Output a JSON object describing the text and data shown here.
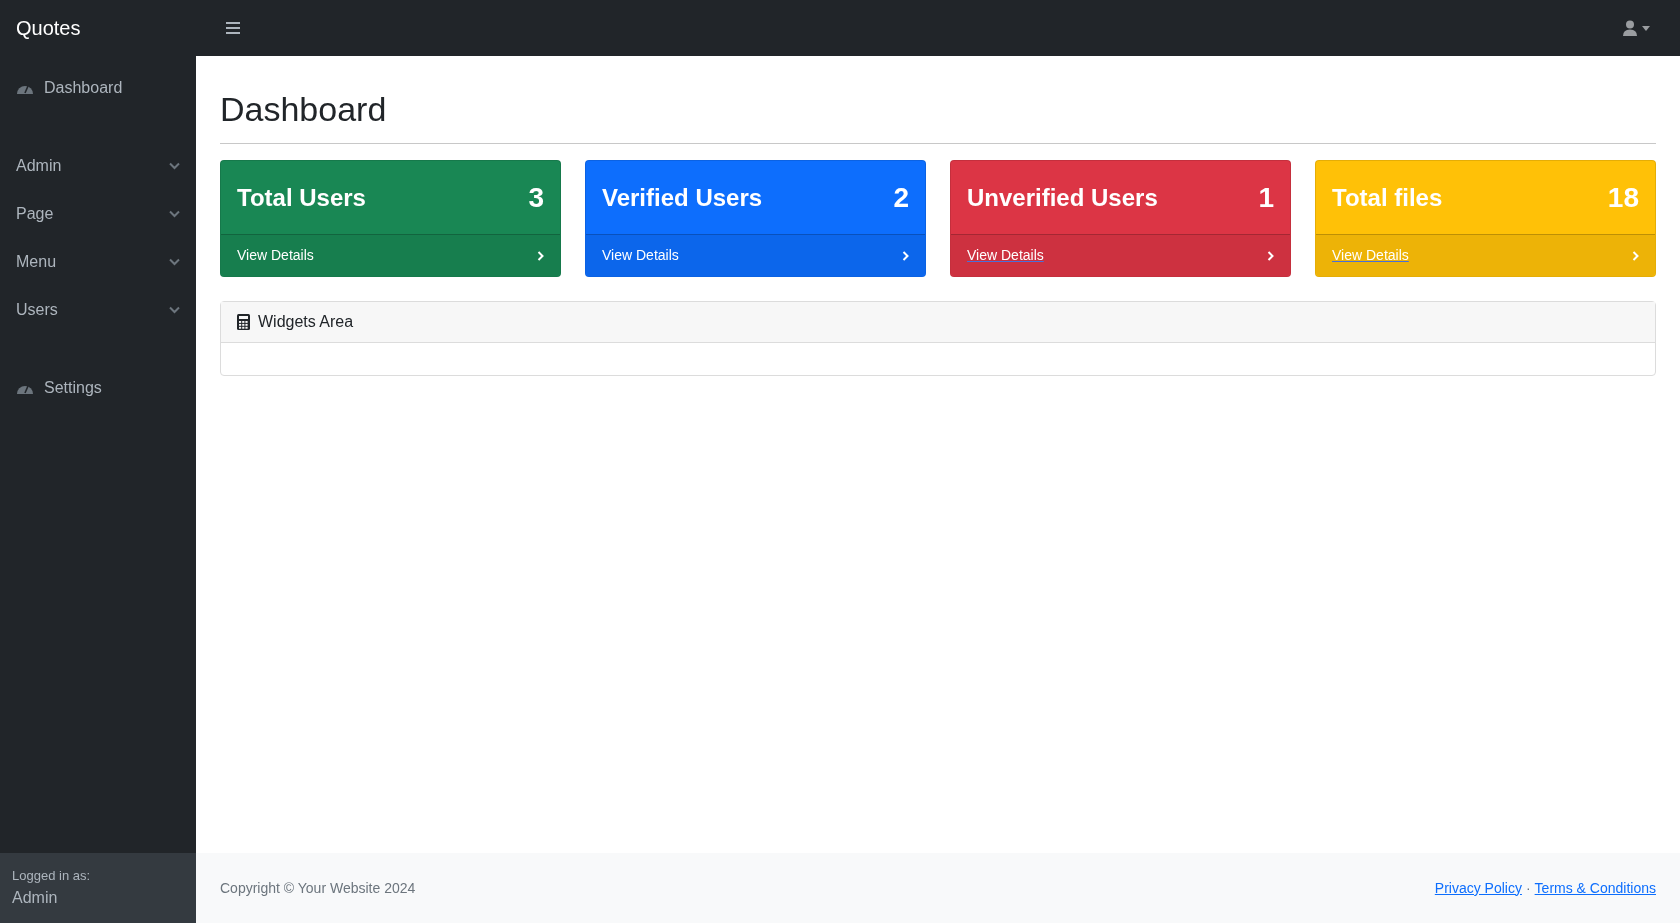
{
  "brand": "Quotes",
  "sidebar": {
    "items": [
      {
        "kind": "link",
        "label": "Dashboard"
      },
      {
        "kind": "dropdown",
        "label": "Admin"
      },
      {
        "kind": "dropdown",
        "label": "Page"
      },
      {
        "kind": "dropdown",
        "label": "Menu"
      },
      {
        "kind": "dropdown",
        "label": "Users"
      },
      {
        "kind": "link",
        "label": "Settings"
      }
    ],
    "footer": {
      "caption": "Logged in as:",
      "user": "Admin"
    }
  },
  "page_title": "Dashboard",
  "cards": [
    {
      "title": "Total Users",
      "count": "3",
      "link": "View Details",
      "color": "#198754",
      "underlined": false
    },
    {
      "title": "Verified Users",
      "count": "2",
      "link": "View Details",
      "color": "#0d6efd",
      "underlined": false
    },
    {
      "title": "Unverified Users",
      "count": "1",
      "link": "View Details",
      "color": "#dc3545",
      "underlined": true
    },
    {
      "title": "Total files",
      "count": "18",
      "link": "View Details",
      "color": "#ffc107",
      "underlined": true
    }
  ],
  "widgets": {
    "title": "Widgets Area"
  },
  "footer": {
    "copyright": "Copyright © Your Website 2024",
    "links": [
      "Privacy Policy",
      "Terms & Conditions"
    ],
    "separator": "·"
  }
}
